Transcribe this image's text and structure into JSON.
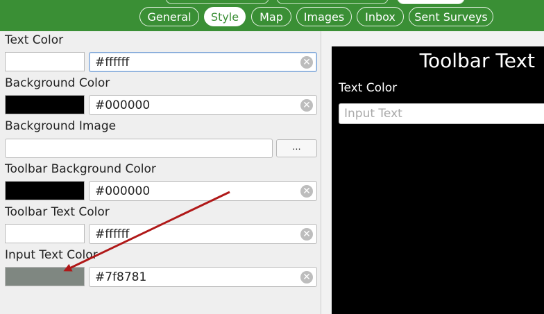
{
  "tabs": [
    {
      "id": "general",
      "label": "General",
      "active": false
    },
    {
      "id": "style",
      "label": "Style",
      "active": true
    },
    {
      "id": "map",
      "label": "Map",
      "active": false
    },
    {
      "id": "images",
      "label": "Images",
      "active": false
    },
    {
      "id": "inbox",
      "label": "Inbox",
      "active": false
    },
    {
      "id": "sent_surveys",
      "label": "Sent Surveys",
      "active": false
    }
  ],
  "form": {
    "text_color": {
      "label": "Text Color",
      "value": "#ffffff",
      "swatch": "#ffffff"
    },
    "background_color": {
      "label": "Background Color",
      "value": "#000000",
      "swatch": "#000000"
    },
    "background_image": {
      "label": "Background Image",
      "value": "",
      "browse_label": "..."
    },
    "toolbar_background_color": {
      "label": "Toolbar Background Color",
      "value": "#000000",
      "swatch": "#000000"
    },
    "toolbar_text_color": {
      "label": "Toolbar Text Color",
      "value": "#ffffff",
      "swatch": "#ffffff"
    },
    "input_text_color": {
      "label": "Input Text Color",
      "value": "#7f8781",
      "swatch": "#7f8781"
    }
  },
  "preview": {
    "toolbar_text": "Toolbar Text",
    "label": "Text Color",
    "input_placeholder": "Input Text"
  },
  "colors": {
    "header_green": "#3a8f35",
    "annotation_arrow": "#b01818"
  }
}
